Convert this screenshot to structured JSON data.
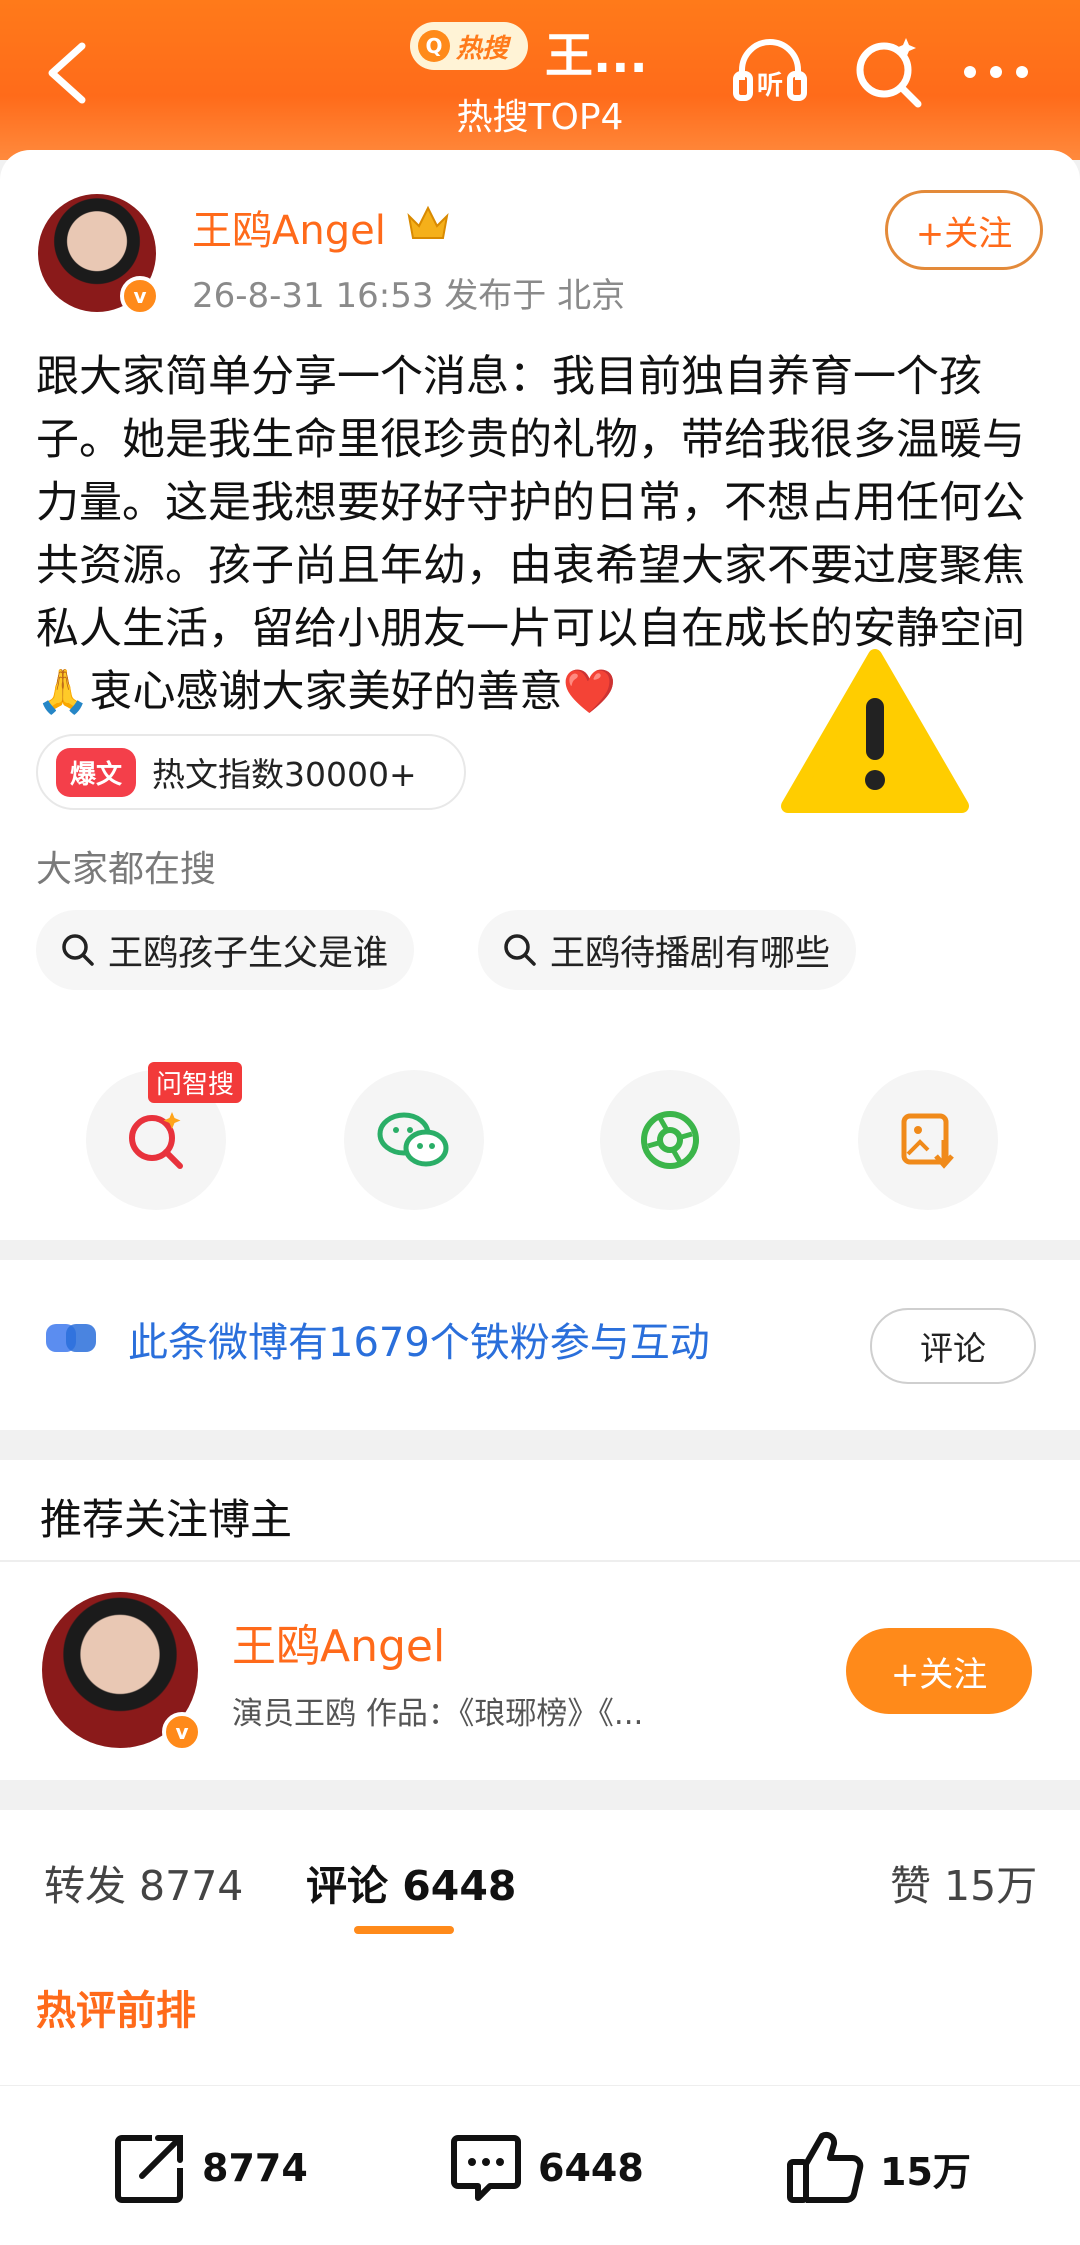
{
  "header": {
    "hot_tag_label": "热搜",
    "title": "王...",
    "subtitle": "热搜TOP4"
  },
  "post": {
    "author": "王鸥Angel",
    "avatar_badge": "v",
    "meta": "26-8-31 16:53  发布于 北京",
    "follow_label": "+关注",
    "text": "跟大家简单分享一个消息：我目前独自养育一个孩子。她是我生命里很珍贵的礼物，带给我很多温暖与力量。这是我想要好好守护的日常，不想占用任何公共资源。孩子尚且年幼，由衷希望大家不要过度聚焦私人生活，留给小朋友一片可以自在成长的安静空间🙏衷心感谢大家美好的善意❤️",
    "hot_badge": "爆文",
    "hot_index": "热文指数30000+",
    "search_label": "大家都在搜",
    "search_chips": [
      "王鸥孩子生父是谁",
      "王鸥待播剧有哪些"
    ],
    "zhisou_tag": "问智搜"
  },
  "fans": {
    "text": "此条微博有1679个铁粉参与互动",
    "comment_label": "评论"
  },
  "recommend": {
    "title": "推荐关注博主",
    "name": "王鸥Angel",
    "desc": "演员王鸥 作品：《琅琊榜》《...",
    "follow_label": "+关注"
  },
  "tabs": {
    "repost": "转发 8774",
    "comment": "评论 6448",
    "like": "赞 15万",
    "hot_comments_label": "热评前排"
  },
  "bottom_bar": {
    "repost": "8774",
    "comment": "6448",
    "like": "15万"
  },
  "colors": {
    "accent": "#ff7a1a",
    "link_blue": "#2a6fdb",
    "hot_red": "#f43f4a"
  },
  "icons": [
    "back-arrow-icon",
    "listen-icon",
    "search-sparkle-icon",
    "more-dots-icon",
    "warning-icon",
    "wechat-icon",
    "moments-icon",
    "save-image-icon",
    "repost-icon",
    "comment-icon",
    "like-icon"
  ]
}
